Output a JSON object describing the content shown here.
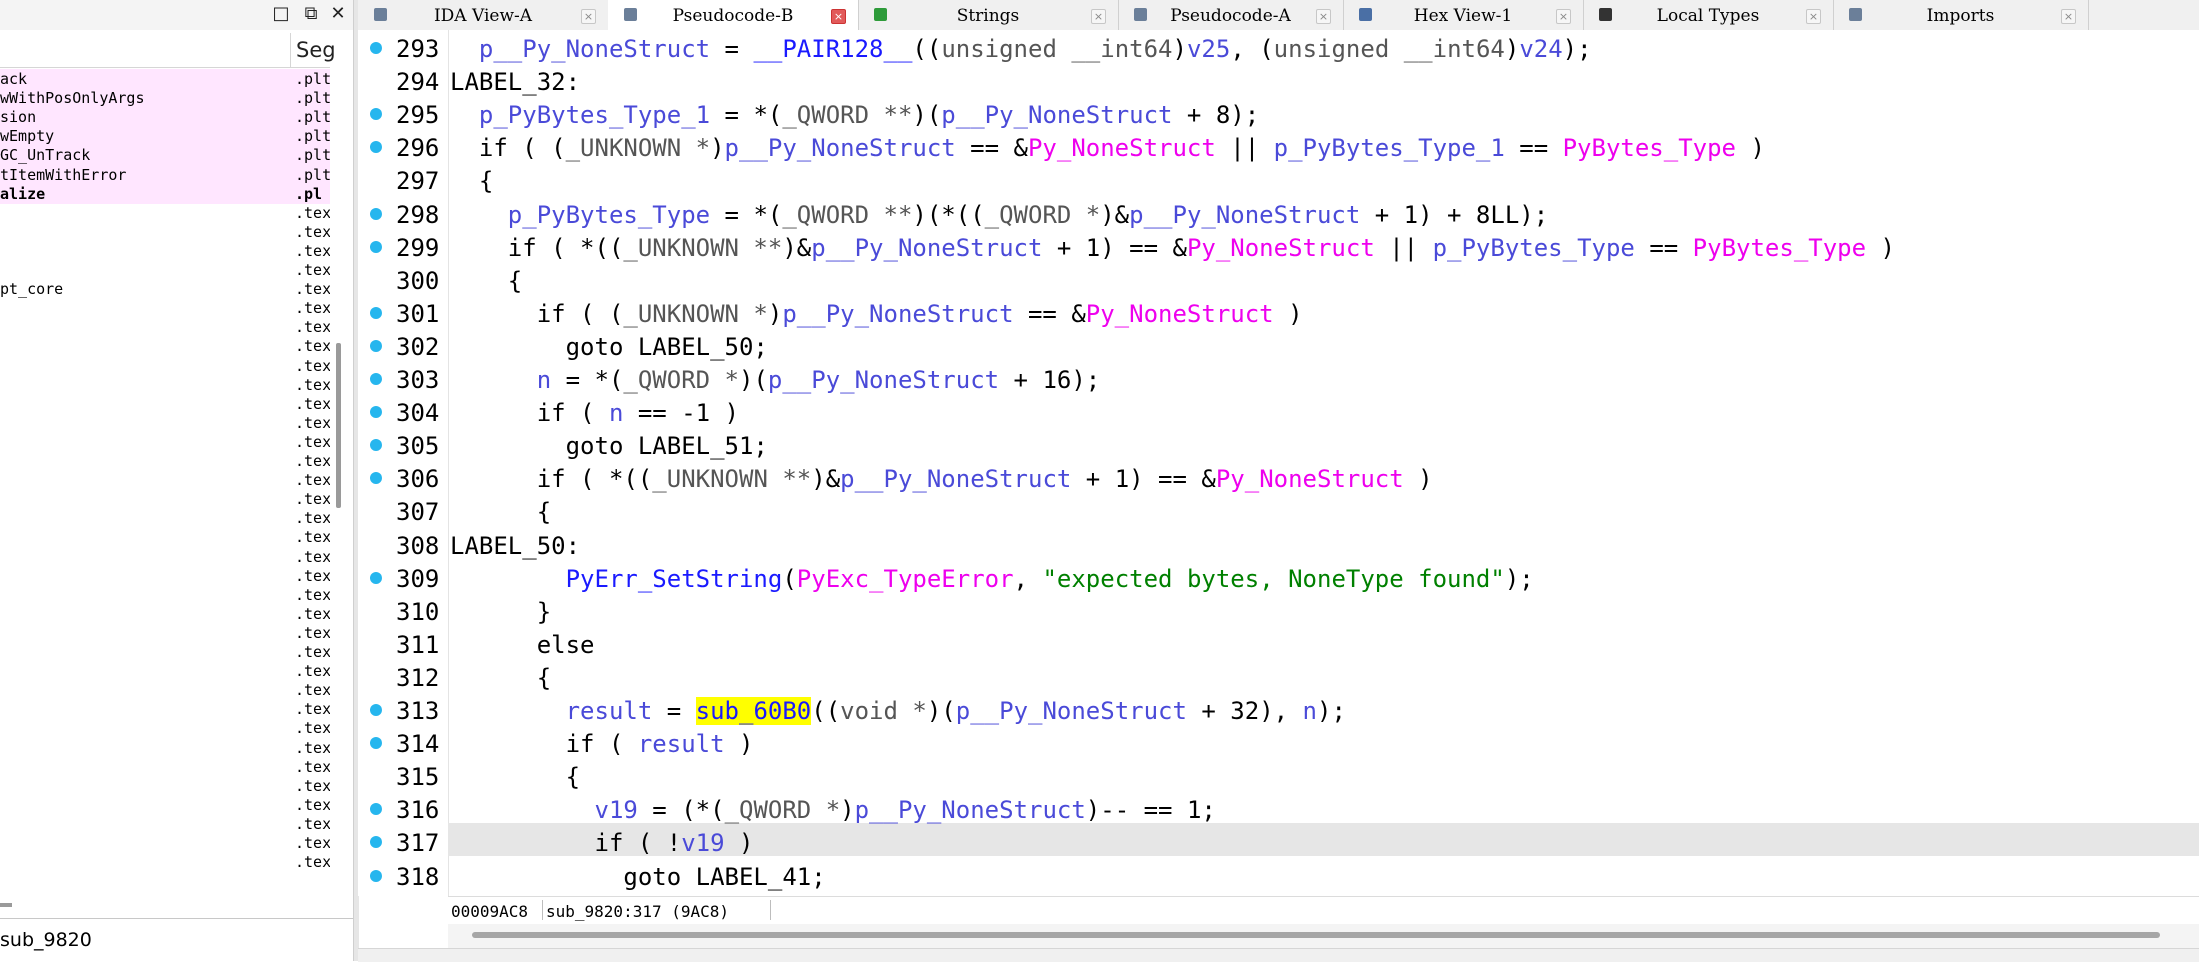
{
  "left_panel": {
    "window_buttons": [
      "□",
      "⧉",
      "✕"
    ],
    "segment_header": "Seg",
    "functions": [
      {
        "name": "ack",
        "seg": ".plt",
        "pink": true,
        "bold": false
      },
      {
        "name": "wWithPosOnlyArgs",
        "seg": ".plt",
        "pink": true,
        "bold": false
      },
      {
        "name": "sion",
        "seg": ".plt",
        "pink": true,
        "bold": false
      },
      {
        "name": "wEmpty",
        "seg": ".plt",
        "pink": true,
        "bold": false
      },
      {
        "name": "GC_UnTrack",
        "seg": ".plt",
        "pink": true,
        "bold": false
      },
      {
        "name": "tItemWithError",
        "seg": ".plt",
        "pink": true,
        "bold": false
      },
      {
        "name": "alize",
        "seg": ".pl",
        "pink": true,
        "bold": true
      },
      {
        "name": "",
        "seg": ".tex",
        "pink": false,
        "bold": false
      },
      {
        "name": "",
        "seg": ".tex",
        "pink": false,
        "bold": false
      },
      {
        "name": "",
        "seg": ".tex",
        "pink": false,
        "bold": false
      },
      {
        "name": "",
        "seg": ".tex",
        "pink": false,
        "bold": false
      },
      {
        "name": "pt_core",
        "seg": ".tex",
        "pink": false,
        "bold": false
      },
      {
        "name": "",
        "seg": ".tex",
        "pink": false,
        "bold": false
      },
      {
        "name": "",
        "seg": ".tex",
        "pink": false,
        "bold": false
      },
      {
        "name": "",
        "seg": ".tex",
        "pink": false,
        "bold": false
      },
      {
        "name": "",
        "seg": ".tex",
        "pink": false,
        "bold": false
      },
      {
        "name": "",
        "seg": ".tex",
        "pink": false,
        "bold": false
      },
      {
        "name": "",
        "seg": ".tex",
        "pink": false,
        "bold": false
      },
      {
        "name": "",
        "seg": ".tex",
        "pink": false,
        "bold": false
      },
      {
        "name": "",
        "seg": ".tex",
        "pink": false,
        "bold": false
      },
      {
        "name": "",
        "seg": ".tex",
        "pink": false,
        "bold": false
      },
      {
        "name": "",
        "seg": ".tex",
        "pink": false,
        "bold": false
      },
      {
        "name": "",
        "seg": ".tex",
        "pink": false,
        "bold": false
      },
      {
        "name": "",
        "seg": ".tex",
        "pink": false,
        "bold": false
      },
      {
        "name": "",
        "seg": ".tex",
        "pink": false,
        "bold": false
      },
      {
        "name": "",
        "seg": ".tex",
        "pink": false,
        "bold": false
      },
      {
        "name": "",
        "seg": ".tex",
        "pink": false,
        "bold": false
      },
      {
        "name": "",
        "seg": ".tex",
        "pink": false,
        "bold": false
      },
      {
        "name": "",
        "seg": ".tex",
        "pink": false,
        "bold": false
      },
      {
        "name": "",
        "seg": ".tex",
        "pink": false,
        "bold": false
      },
      {
        "name": "",
        "seg": ".tex",
        "pink": false,
        "bold": false
      },
      {
        "name": "",
        "seg": ".tex",
        "pink": false,
        "bold": false
      },
      {
        "name": "",
        "seg": ".tex",
        "pink": false,
        "bold": false
      },
      {
        "name": "",
        "seg": ".tex",
        "pink": false,
        "bold": false
      },
      {
        "name": "",
        "seg": ".tex",
        "pink": false,
        "bold": false
      },
      {
        "name": "",
        "seg": ".tex",
        "pink": false,
        "bold": false
      },
      {
        "name": "",
        "seg": ".tex",
        "pink": false,
        "bold": false
      },
      {
        "name": "",
        "seg": ".tex",
        "pink": false,
        "bold": false
      },
      {
        "name": "",
        "seg": ".tex",
        "pink": false,
        "bold": false
      },
      {
        "name": "",
        "seg": ".tex",
        "pink": false,
        "bold": false
      },
      {
        "name": "",
        "seg": ".tex",
        "pink": false,
        "bold": false
      },
      {
        "name": "",
        "seg": ".tex",
        "pink": false,
        "bold": false
      }
    ],
    "status_text": "sub_9820"
  },
  "tabs": [
    {
      "label": "IDA View-A",
      "icon": "ida-view-icon",
      "icon_color": "#6b7f99",
      "active": false
    },
    {
      "label": "Pseudocode-B",
      "icon": "pseudocode-icon",
      "icon_color": "#6b7f99",
      "active": true
    },
    {
      "label": "Strings",
      "icon": "strings-icon",
      "icon_color": "#2e9b3a",
      "active": false
    },
    {
      "label": "Pseudocode-A",
      "icon": "pseudocode-icon",
      "icon_color": "#6b7f99",
      "active": false
    },
    {
      "label": "Hex View-1",
      "icon": "hex-view-icon",
      "icon_color": "#4a6fa5",
      "active": false
    },
    {
      "label": "Local Types",
      "icon": "local-types-icon",
      "icon_color": "#333333",
      "active": false
    },
    {
      "label": "Imports",
      "icon": "imports-icon",
      "icon_color": "#6b7f99",
      "active": false
    }
  ],
  "code_lines": [
    {
      "num": "293",
      "dot": true,
      "segments": [
        [
          "  ",
          "t"
        ],
        [
          "p__Py_NoneStruct",
          "v"
        ],
        [
          " = ",
          "k"
        ],
        [
          "__PAIR128__",
          "f"
        ],
        [
          "((",
          "k"
        ],
        [
          "unsigned __int64",
          "t"
        ],
        [
          ")",
          "k"
        ],
        [
          "v25",
          "v"
        ],
        [
          ", (",
          "k"
        ],
        [
          "unsigned __int64",
          "t"
        ],
        [
          ")",
          "k"
        ],
        [
          "v24",
          "v"
        ],
        [
          ");",
          "k"
        ]
      ]
    },
    {
      "num": "294",
      "dot": false,
      "segments": [
        [
          "LABEL_32:",
          "k"
        ]
      ]
    },
    {
      "num": "295",
      "dot": true,
      "segments": [
        [
          "  ",
          "t"
        ],
        [
          "p_PyBytes_Type_1",
          "v"
        ],
        [
          " = *(",
          "k"
        ],
        [
          "_QWORD **",
          "t"
        ],
        [
          ")(",
          "k"
        ],
        [
          "p__Py_NoneStruct",
          "v"
        ],
        [
          " + 8);",
          "k"
        ]
      ]
    },
    {
      "num": "296",
      "dot": true,
      "segments": [
        [
          "  if ( (",
          "k"
        ],
        [
          "_UNKNOWN *",
          "t"
        ],
        [
          ")",
          "k"
        ],
        [
          "p__Py_NoneStruct",
          "v"
        ],
        [
          " == &",
          "k"
        ],
        [
          "Py_NoneStruct",
          "g"
        ],
        [
          " || ",
          "k"
        ],
        [
          "p_PyBytes_Type_1",
          "v"
        ],
        [
          " == ",
          "k"
        ],
        [
          "PyBytes_Type",
          "g"
        ],
        [
          " )",
          "k"
        ]
      ]
    },
    {
      "num": "297",
      "dot": false,
      "segments": [
        [
          "  {",
          "k"
        ]
      ]
    },
    {
      "num": "298",
      "dot": true,
      "segments": [
        [
          "    ",
          "t"
        ],
        [
          "p_PyBytes_Type",
          "v"
        ],
        [
          " = *(",
          "k"
        ],
        [
          "_QWORD **",
          "t"
        ],
        [
          ")(*((",
          "k"
        ],
        [
          "_QWORD *",
          "t"
        ],
        [
          ")&",
          "k"
        ],
        [
          "p__Py_NoneStruct",
          "v"
        ],
        [
          " + 1) + 8LL);",
          "k"
        ]
      ]
    },
    {
      "num": "299",
      "dot": true,
      "segments": [
        [
          "    if ( *((",
          "k"
        ],
        [
          "_UNKNOWN **",
          "t"
        ],
        [
          ")&",
          "k"
        ],
        [
          "p__Py_NoneStruct",
          "v"
        ],
        [
          " + 1) == &",
          "k"
        ],
        [
          "Py_NoneStruct",
          "g"
        ],
        [
          " || ",
          "k"
        ],
        [
          "p_PyBytes_Type",
          "v"
        ],
        [
          " == ",
          "k"
        ],
        [
          "PyBytes_Type",
          "g"
        ],
        [
          " )",
          "k"
        ]
      ]
    },
    {
      "num": "300",
      "dot": false,
      "segments": [
        [
          "    {",
          "k"
        ]
      ]
    },
    {
      "num": "301",
      "dot": true,
      "segments": [
        [
          "      if ( (",
          "k"
        ],
        [
          "_UNKNOWN *",
          "t"
        ],
        [
          ")",
          "k"
        ],
        [
          "p__Py_NoneStruct",
          "v"
        ],
        [
          " == &",
          "k"
        ],
        [
          "Py_NoneStruct",
          "g"
        ],
        [
          " )",
          "k"
        ]
      ]
    },
    {
      "num": "302",
      "dot": true,
      "segments": [
        [
          "        goto LABEL_50;",
          "k"
        ]
      ]
    },
    {
      "num": "303",
      "dot": true,
      "segments": [
        [
          "      ",
          "t"
        ],
        [
          "n",
          "v"
        ],
        [
          " = *(",
          "k"
        ],
        [
          "_QWORD *",
          "t"
        ],
        [
          ")(",
          "k"
        ],
        [
          "p__Py_NoneStruct",
          "v"
        ],
        [
          " + 16);",
          "k"
        ]
      ]
    },
    {
      "num": "304",
      "dot": true,
      "segments": [
        [
          "      if ( ",
          "k"
        ],
        [
          "n",
          "v"
        ],
        [
          " == -1 )",
          "k"
        ]
      ]
    },
    {
      "num": "305",
      "dot": true,
      "segments": [
        [
          "        goto LABEL_51;",
          "k"
        ]
      ]
    },
    {
      "num": "306",
      "dot": true,
      "segments": [
        [
          "      if ( *((",
          "k"
        ],
        [
          "_UNKNOWN **",
          "t"
        ],
        [
          ")&",
          "k"
        ],
        [
          "p__Py_NoneStruct",
          "v"
        ],
        [
          " + 1) == &",
          "k"
        ],
        [
          "Py_NoneStruct",
          "g"
        ],
        [
          " )",
          "k"
        ]
      ]
    },
    {
      "num": "307",
      "dot": false,
      "segments": [
        [
          "      {",
          "k"
        ]
      ]
    },
    {
      "num": "308",
      "dot": false,
      "segments": [
        [
          "LABEL_50:",
          "k"
        ]
      ]
    },
    {
      "num": "309",
      "dot": true,
      "segments": [
        [
          "        ",
          "t"
        ],
        [
          "PyErr_SetString",
          "f"
        ],
        [
          "(",
          "k"
        ],
        [
          "PyExc_TypeError",
          "g"
        ],
        [
          ", ",
          "k"
        ],
        [
          "\"expected bytes, NoneType found\"",
          "s"
        ],
        [
          ");",
          "k"
        ]
      ]
    },
    {
      "num": "310",
      "dot": false,
      "segments": [
        [
          "      }",
          "k"
        ]
      ]
    },
    {
      "num": "311",
      "dot": false,
      "segments": [
        [
          "      else",
          "k"
        ]
      ]
    },
    {
      "num": "312",
      "dot": false,
      "segments": [
        [
          "      {",
          "k"
        ]
      ]
    },
    {
      "num": "313",
      "dot": true,
      "segments": [
        [
          "        ",
          "t"
        ],
        [
          "result",
          "v"
        ],
        [
          " = ",
          "k"
        ],
        [
          "sub_60B0",
          "h"
        ],
        [
          "((",
          "k"
        ],
        [
          "void *",
          "t"
        ],
        [
          ")(",
          "k"
        ],
        [
          "p__Py_NoneStruct",
          "v"
        ],
        [
          " + 32), ",
          "k"
        ],
        [
          "n",
          "v"
        ],
        [
          ");",
          "k"
        ]
      ]
    },
    {
      "num": "314",
      "dot": true,
      "segments": [
        [
          "        if ( ",
          "k"
        ],
        [
          "result",
          "v"
        ],
        [
          " )",
          "k"
        ]
      ]
    },
    {
      "num": "315",
      "dot": false,
      "segments": [
        [
          "        {",
          "k"
        ]
      ]
    },
    {
      "num": "316",
      "dot": true,
      "segments": [
        [
          "          ",
          "t"
        ],
        [
          "v19",
          "v"
        ],
        [
          " = (*(",
          "k"
        ],
        [
          "_QWORD *",
          "t"
        ],
        [
          ")",
          "k"
        ],
        [
          "p__Py_NoneStruct",
          "v"
        ],
        [
          ")-- == 1;",
          "k"
        ]
      ]
    },
    {
      "num": "317",
      "dot": true,
      "segments": [
        [
          "          if ( !",
          "k"
        ],
        [
          "v19",
          "v"
        ],
        [
          " )",
          "k"
        ]
      ]
    },
    {
      "num": "318",
      "dot": true,
      "segments": [
        [
          "            goto LABEL_41;",
          "k"
        ]
      ]
    }
  ],
  "highlighted_line": "317",
  "code_status": {
    "address": "00009AC8",
    "location": "sub_9820:317 (9AC8)"
  }
}
